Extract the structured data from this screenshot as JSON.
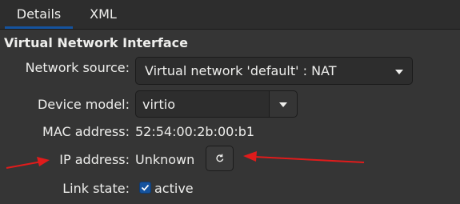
{
  "tabs": [
    {
      "label": "Details",
      "active": true
    },
    {
      "label": "XML",
      "active": false
    }
  ],
  "section_title": "Virtual Network Interface",
  "fields": {
    "network_source": {
      "label": "Network source:",
      "value": "Virtual network 'default' : NAT"
    },
    "device_model": {
      "label": "Device model:",
      "value": "virtio"
    },
    "mac_address": {
      "label": "MAC address:",
      "value": "52:54:00:2b:00:b1"
    },
    "ip_address": {
      "label": "IP address:",
      "value": "Unknown"
    },
    "link_state": {
      "label": "Link state:",
      "value": "active",
      "checked": true
    }
  },
  "icons": {
    "refresh": "refresh-icon",
    "dropdown": "chevron-down-icon",
    "check": "checkmark-icon"
  },
  "colors": {
    "background": "#353535",
    "accent": "#15539e",
    "annotation_arrow": "#e01b1b"
  }
}
